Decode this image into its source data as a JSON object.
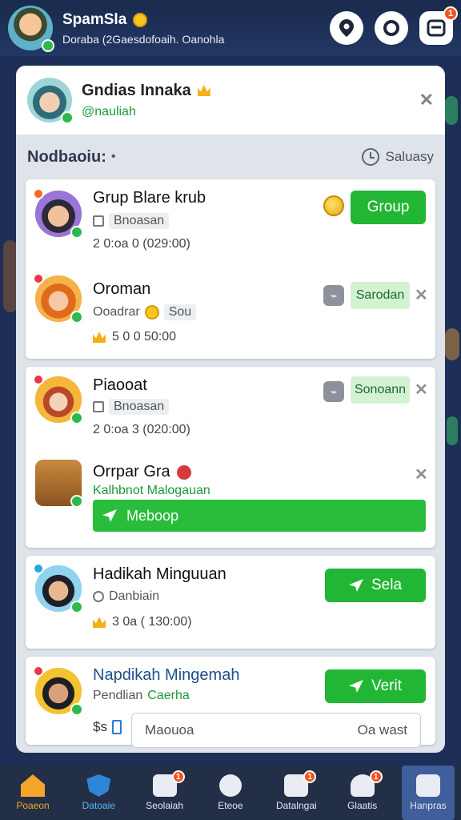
{
  "header": {
    "title": "SpamSla",
    "subtitle": "Doraba (2Gaesdofoaih. Oanohla",
    "notification_count": "1",
    "icons": [
      "location-pin-icon",
      "settings-icon",
      "inbox-icon"
    ]
  },
  "panel": {
    "profile_name": "Gndias Innaka",
    "profile_handle": "@nauliah",
    "section_title": "Nodbaoiu:",
    "section_action": "Saluasy"
  },
  "items": [
    {
      "name": "Grup Blare krub",
      "sub": "Bnoasan",
      "meta": "2 0:oa 0 (029:00)",
      "action": "Group"
    },
    {
      "name": "Oroman",
      "sub": "Ooadrar",
      "sub_chip": "Sou",
      "meta": "5 0 0 50:00",
      "action": "Sarodan"
    },
    {
      "name": "Piaooat",
      "sub": "Bnoasan",
      "meta": "2 0:oa 3 (020:00)",
      "action": "Sonoann"
    },
    {
      "name": "Orrpar Gra",
      "sub": "Kalhbnot Malogauan",
      "action": "Meboop"
    },
    {
      "name": "Hadikah Minguuan",
      "sub": "Danbiain",
      "meta": "3 0a ( 130:00)",
      "action": "Sela"
    },
    {
      "name": "Napdikah Mingemah",
      "sub": "Pendlian",
      "sub_accent": "Caerha",
      "action": "Verit"
    }
  ],
  "note": {
    "prefix": "$s",
    "placeholder": "Maouoa",
    "right": "Oa wast"
  },
  "bottom_nav": [
    {
      "label": "Poaeon",
      "badge": ""
    },
    {
      "label": "Datoaie",
      "badge": ""
    },
    {
      "label": "Seolaiah",
      "badge": "1"
    },
    {
      "label": "Eteoe",
      "badge": ""
    },
    {
      "label": "Datalngai",
      "badge": "1"
    },
    {
      "label": "Glaatis",
      "badge": "1"
    },
    {
      "label": "Hanpras",
      "badge": ""
    }
  ],
  "colors": {
    "background": "#1d2f57",
    "accent_green": "#22b635",
    "badge_orange": "#f0541e",
    "handle_green": "#1a9a3a"
  }
}
